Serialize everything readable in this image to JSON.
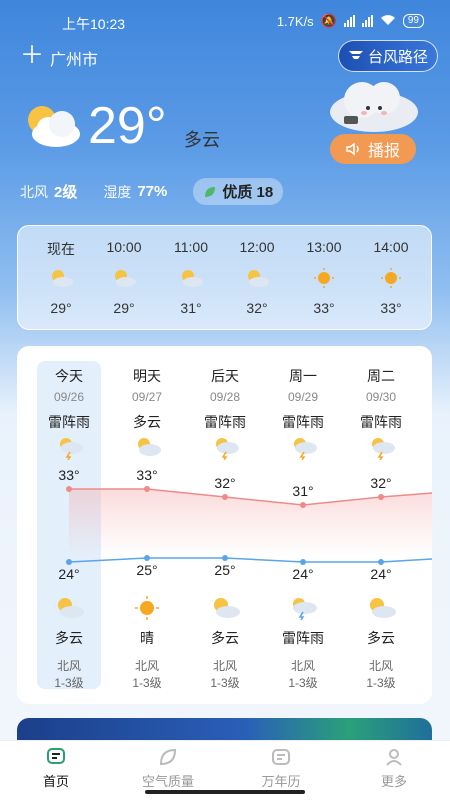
{
  "status_bar": {
    "time": "上午10:23",
    "speed": "1.7K/s",
    "battery": "99"
  },
  "header": {
    "add_icon": "plus-icon",
    "city": "广州市",
    "typhoon_label": "台风路径"
  },
  "current": {
    "temperature": "29°",
    "condition": "多云",
    "broadcast_label": "播报"
  },
  "details": {
    "wind_label": "北风",
    "wind_value": "2级",
    "humidity_label": "湿度",
    "humidity_value": "77%",
    "aq_value": "优质 18"
  },
  "hourly": [
    {
      "time": "现在",
      "icon": "partly-cloudy",
      "temp": "29°"
    },
    {
      "time": "10:00",
      "icon": "partly-cloudy",
      "temp": "29°"
    },
    {
      "time": "11:00",
      "icon": "partly-cloudy",
      "temp": "31°"
    },
    {
      "time": "12:00",
      "icon": "partly-cloudy",
      "temp": "32°"
    },
    {
      "time": "13:00",
      "icon": "sunny",
      "temp": "33°"
    },
    {
      "time": "14:00",
      "icon": "sunny",
      "temp": "33°"
    }
  ],
  "daily": [
    {
      "name": "今天",
      "date": "09/26",
      "day_cond": "雷阵雨",
      "high": 33,
      "high_label": "33°",
      "low": 24,
      "low_label": "24°",
      "night_cond": "多云",
      "night_icon": "partly-cloudy",
      "wind": "北风",
      "level": "1-3级"
    },
    {
      "name": "明天",
      "date": "09/27",
      "day_cond": "多云",
      "high": 33,
      "high_label": "33°",
      "low": 25,
      "low_label": "25°",
      "night_cond": "晴",
      "night_icon": "sunny",
      "wind": "北风",
      "level": "1-3级"
    },
    {
      "name": "后天",
      "date": "09/28",
      "day_cond": "雷阵雨",
      "high": 32,
      "high_label": "32°",
      "low": 25,
      "low_label": "25°",
      "night_cond": "多云",
      "night_icon": "partly-cloudy",
      "wind": "北风",
      "level": "1-3级"
    },
    {
      "name": "周一",
      "date": "09/29",
      "day_cond": "雷阵雨",
      "high": 31,
      "high_label": "31°",
      "low": 24,
      "low_label": "24°",
      "night_cond": "雷阵雨",
      "night_icon": "thunder",
      "wind": "北风",
      "level": "1-3级"
    },
    {
      "name": "周二",
      "date": "09/30",
      "day_cond": "雷阵雨",
      "high": 32,
      "high_label": "32°",
      "low": 24,
      "low_label": "24°",
      "night_cond": "多云",
      "night_icon": "partly-cloudy",
      "wind": "北风",
      "level": "1-3级"
    }
  ],
  "tabs": [
    {
      "label": "首页",
      "icon": "home-icon",
      "active": true
    },
    {
      "label": "空气质量",
      "icon": "leaf-icon",
      "active": false
    },
    {
      "label": "万年历",
      "icon": "calendar-icon",
      "active": false
    },
    {
      "label": "更多",
      "icon": "user-icon",
      "active": false
    }
  ],
  "colors": {
    "high_line": "#f08a8a",
    "low_line": "#5aa5e8",
    "broadcast": "#f39a52",
    "accent_blue": "#3f86dc"
  }
}
